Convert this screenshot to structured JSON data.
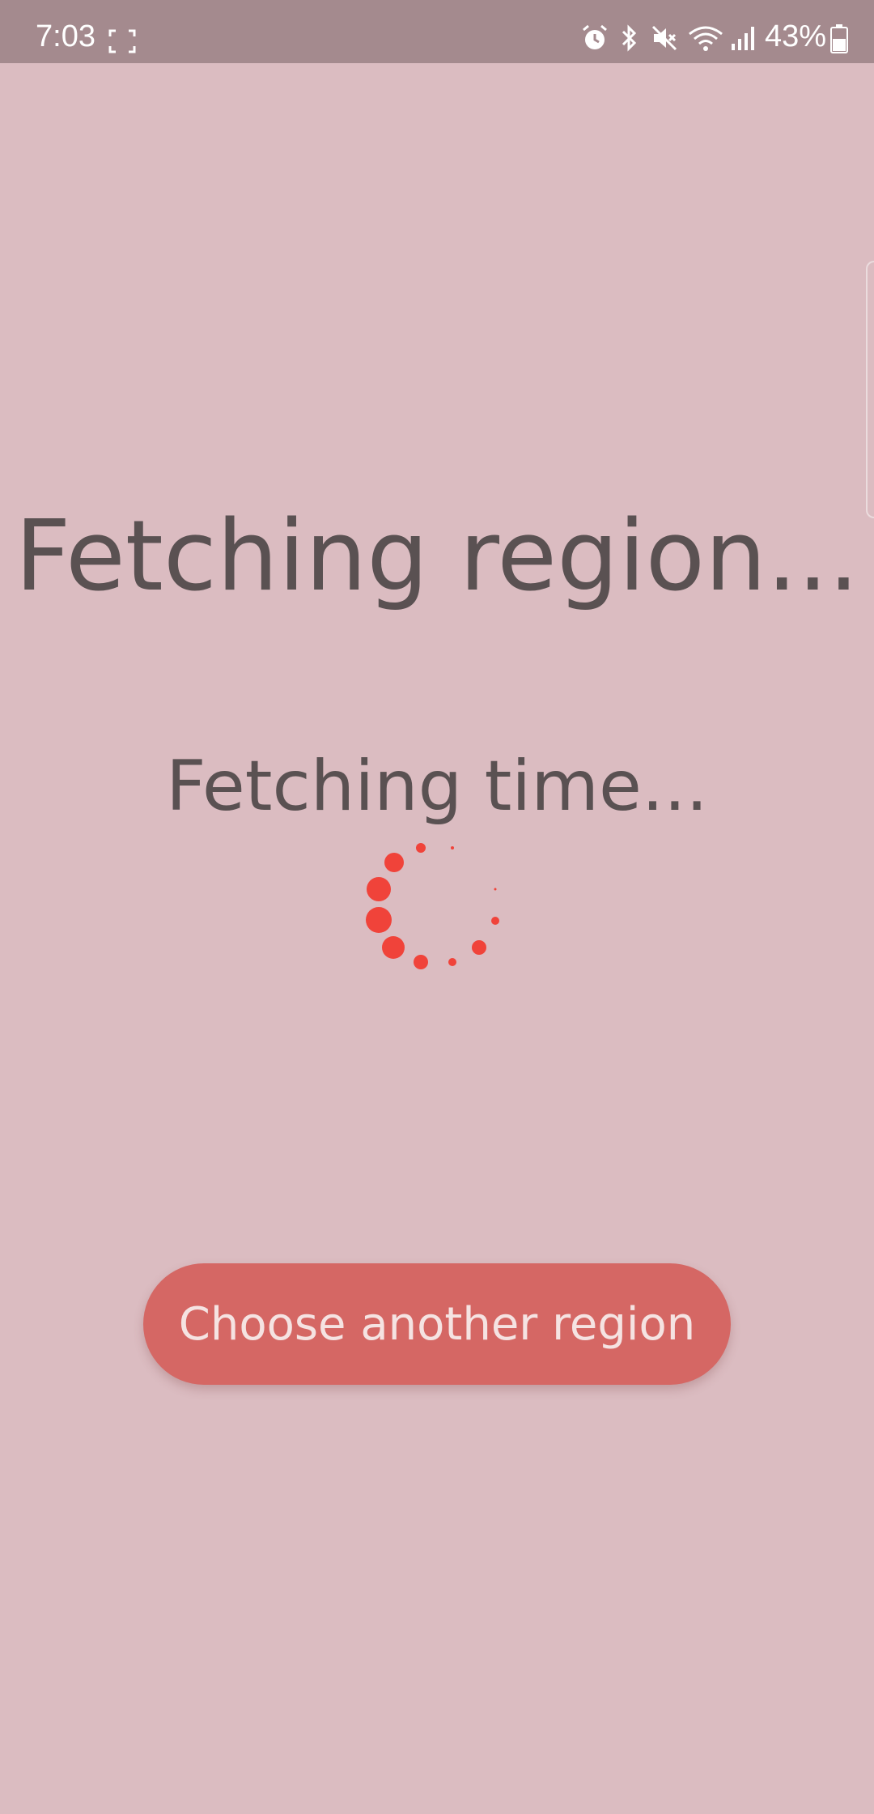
{
  "status_bar": {
    "time": "7:03",
    "battery_percent": "43%",
    "icons": [
      "screenshot-icon",
      "alarm-icon",
      "bluetooth-icon",
      "mute-icon",
      "wifi-icon",
      "signal-icon",
      "battery-icon"
    ]
  },
  "main": {
    "region_status": "Fetching region...",
    "time_status": "Fetching time...",
    "spinner_color": "#f0433a"
  },
  "actions": {
    "choose_region_label": "Choose another region"
  },
  "colors": {
    "background": "#dbbcc1",
    "status_bar": "#a48a8e",
    "button": "#d56764",
    "text": "#5a5152"
  }
}
